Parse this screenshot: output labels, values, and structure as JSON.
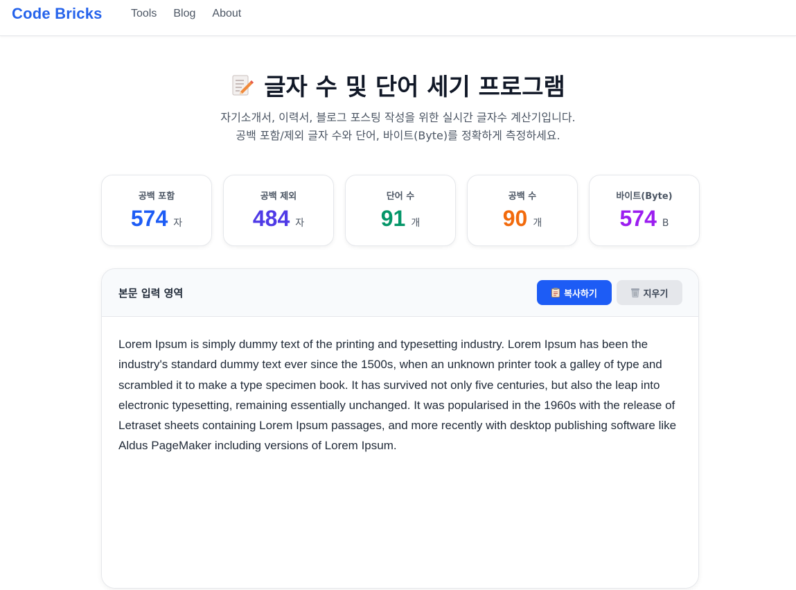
{
  "header": {
    "logo": "Code Bricks",
    "nav": [
      "Tools",
      "Blog",
      "About"
    ]
  },
  "hero": {
    "title": "글자 수 및 단어 세기 프로그램",
    "icon": "memo-icon",
    "subtitle_line1": "자기소개서, 이력서, 블로그 포스팅 작성을 위한 실시간 글자수 계산기입니다.",
    "subtitle_line2": "공백 포함/제외 글자 수와 단어, 바이트(Byte)를 정확하게 측정하세요."
  },
  "stats": [
    {
      "label": "공백 포함",
      "value": "574",
      "unit": "자",
      "color": "#1d5cf5"
    },
    {
      "label": "공백 제외",
      "value": "484",
      "unit": "자",
      "color": "#4f3ae6"
    },
    {
      "label": "단어 수",
      "value": "91",
      "unit": "개",
      "color": "#059669"
    },
    {
      "label": "공백 수",
      "value": "90",
      "unit": "개",
      "color": "#f26a0c"
    },
    {
      "label": "바이트(Byte)",
      "value": "574",
      "unit": "B",
      "color": "#9b1df0"
    }
  ],
  "editor": {
    "title": "본문 입력 영역",
    "copy_label": "복사하기",
    "clear_label": "지우기",
    "content": "Lorem Ipsum is simply dummy text of the printing and typesetting industry. Lorem Ipsum has been the industry's standard dummy text ever since the 1500s, when an unknown printer took a galley of type and scrambled it to make a type specimen book. It has survived not only five centuries, but also the leap into electronic typesetting, remaining essentially unchanged. It was popularised in the 1960s with the release of Letraset sheets containing Lorem Ipsum passages, and more recently with desktop publishing software like Aldus PageMaker including versions of Lorem Ipsum."
  },
  "colors": {
    "brand": "#2563eb",
    "primary_button": "#1d5cf5",
    "secondary_button": "#e5e7eb"
  }
}
